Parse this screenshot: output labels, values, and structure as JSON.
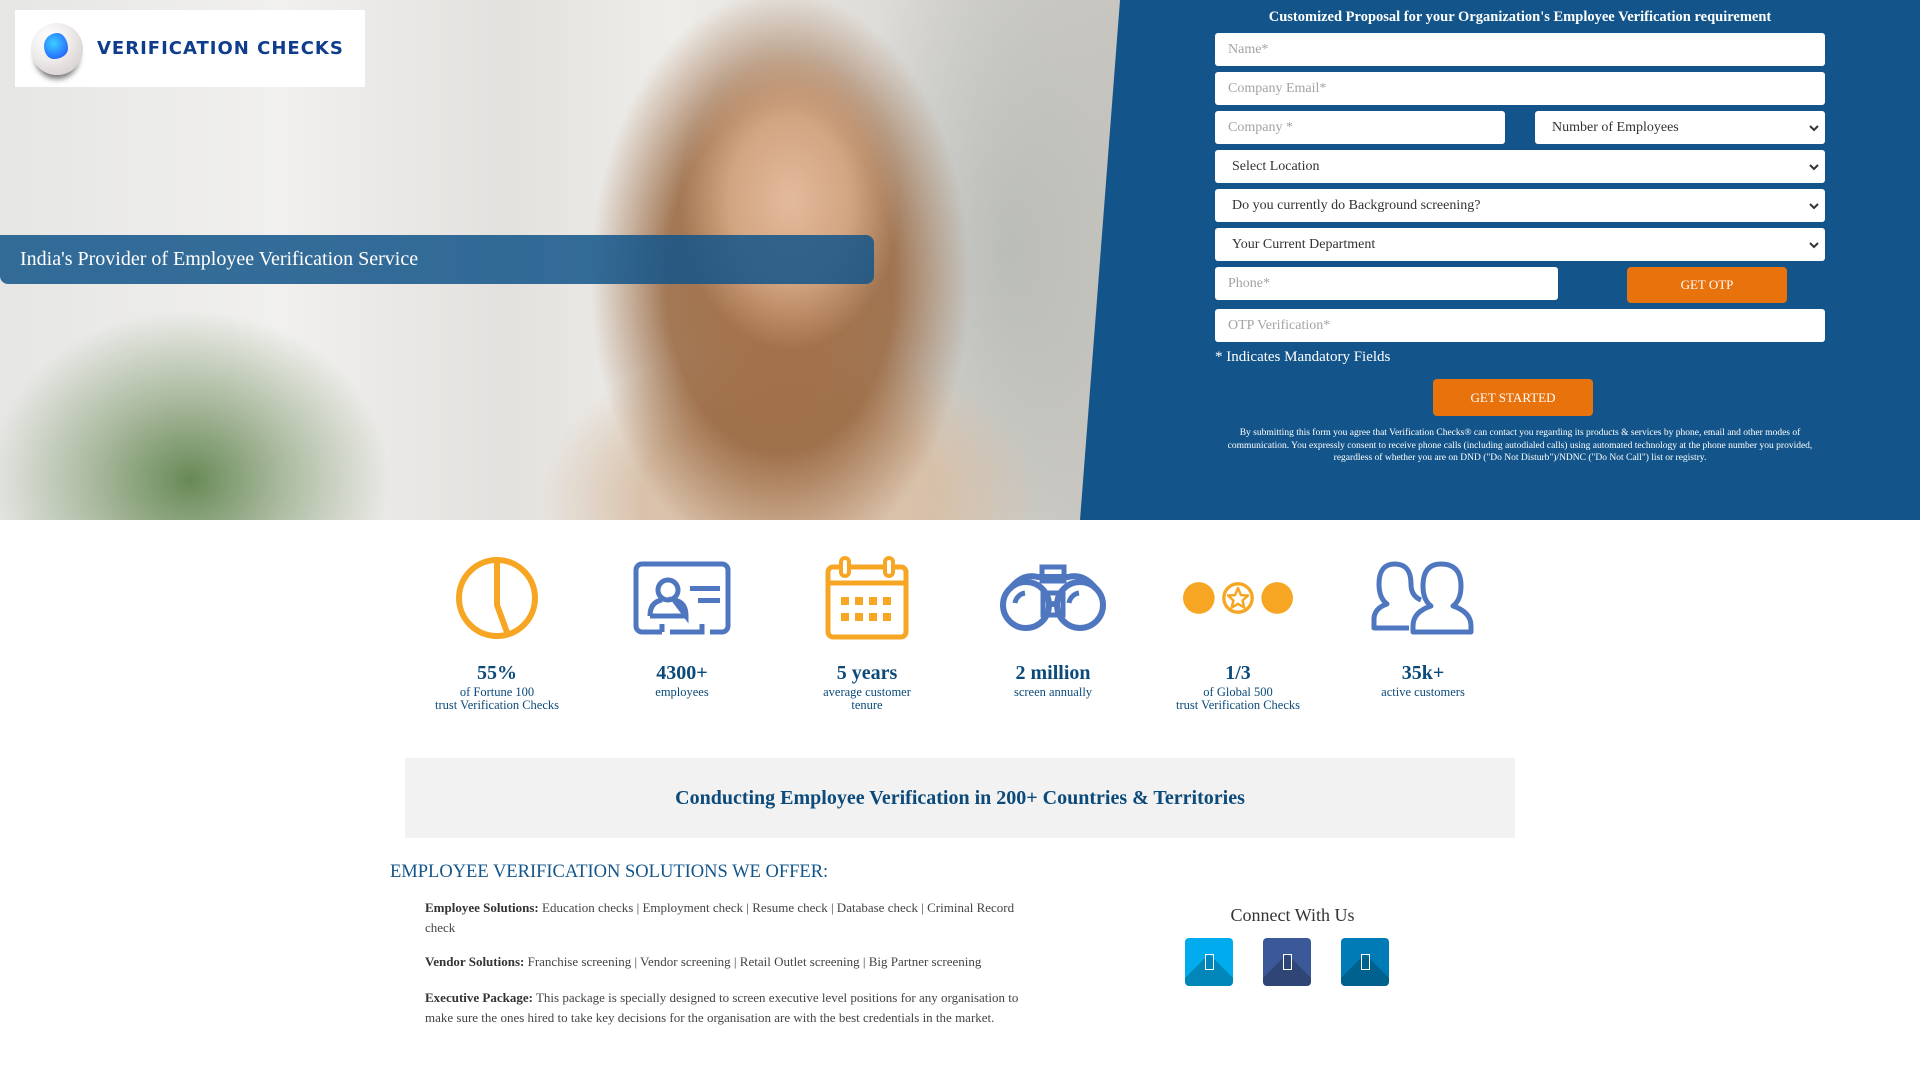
{
  "brand": {
    "logo_text": "VERIFICATION CHECKS",
    "tagline": "India's Provider of Employee Verification Service",
    "colors": {
      "primary_blue": "#13558a",
      "text_blue": "#0b4a7a",
      "orange": "#e8720c",
      "icon_orange": "#f6a623",
      "icon_blue": "#4f77c0"
    }
  },
  "form": {
    "title": "Customized Proposal for your Organization's Employee Verification requirement",
    "name_placeholder": "Name*",
    "email_placeholder": "Company Email*",
    "company_placeholder": "Company *",
    "employees_select": "Number of Employees",
    "location_select": "Select Location",
    "screening_select": "Do you currently do Background screening?",
    "department_select": "Your Current Department",
    "phone_placeholder": "Phone*",
    "get_otp_label": "GET OTP",
    "otp_placeholder": "OTP Verification*",
    "mandatory_note": "* Indicates Mandatory Fields",
    "submit_label": "GET STARTED",
    "disclaimer": "By submitting this form you agree that Verification Checks® can contact you regarding its products & services by phone, email and other modes of communication. You expressly consent to receive phone calls (including autodialed calls) using automated technology at the phone number you provided, regardless of whether you are on DND (\"Do Not Disturb\")/NDNC (\"Do Not Call\") list or registry."
  },
  "stats": [
    {
      "icon": "pie-chart-icon",
      "value": "55%",
      "label_line1": "of Fortune 100",
      "label_line2": "trust Verification Checks"
    },
    {
      "icon": "id-card-icon",
      "value": "4300+",
      "label_line1": "employees",
      "label_line2": ""
    },
    {
      "icon": "calendar-icon",
      "value": "5 years",
      "label_line1": "average customer",
      "label_line2": "tenure"
    },
    {
      "icon": "binoculars-icon",
      "value": "2 million",
      "label_line1": "screen annually",
      "label_line2": ""
    },
    {
      "icon": "star-coins-icon",
      "value": "1/3",
      "label_line1": "of Global 500",
      "label_line2": "trust Verification Checks"
    },
    {
      "icon": "users-icon",
      "value": "35k+",
      "label_line1": "active customers",
      "label_line2": ""
    }
  ],
  "band": {
    "text": "Conducting Employee Verification in 200+ Countries & Territories"
  },
  "solutions": {
    "title": "EMPLOYEE VERIFICATION SOLUTIONS WE OFFER:",
    "items": [
      {
        "heading": "Employee Solutions:",
        "text": " Education checks | Employment check | Resume check | Database check | Criminal Record check"
      },
      {
        "heading": "Vendor Solutions:",
        "text": " Franchise screening | Vendor screening | Retail Outlet screening | Big Partner screening"
      },
      {
        "heading": "Executive Package:",
        "text": " This package is specially designed to screen executive level positions for any organisation to make sure the ones hired to take key decisions for the organisation are with the best credentials in the market."
      }
    ]
  },
  "connect": {
    "title": "Connect With Us",
    "social": [
      {
        "name": "twitter",
        "color": "#00aced"
      },
      {
        "name": "facebook",
        "color": "#3b5998"
      },
      {
        "name": "linkedin",
        "color": "#007bb6"
      }
    ]
  }
}
